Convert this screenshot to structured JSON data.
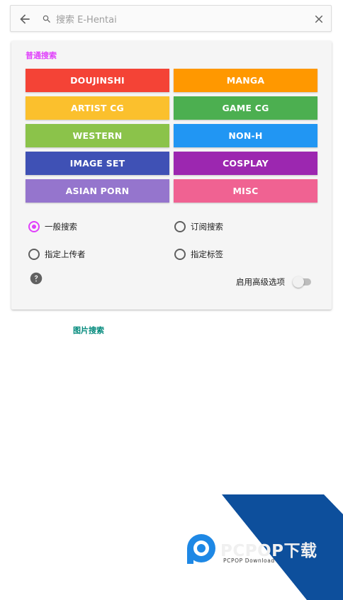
{
  "search": {
    "placeholder": "搜索 E-Hentai",
    "value": ""
  },
  "normal_search": {
    "title": "普通搜索",
    "categories": [
      {
        "label": "DOUJINSHI",
        "color": "#f44336"
      },
      {
        "label": "MANGA",
        "color": "#ff9800"
      },
      {
        "label": "ARTIST CG",
        "color": "#fbc02d"
      },
      {
        "label": "GAME CG",
        "color": "#4caf50"
      },
      {
        "label": "WESTERN",
        "color": "#8bc34a"
      },
      {
        "label": "NON-H",
        "color": "#2196f3"
      },
      {
        "label": "IMAGE SET",
        "color": "#3f51b5"
      },
      {
        "label": "COSPLAY",
        "color": "#9c27b0"
      },
      {
        "label": "ASIAN PORN",
        "color": "#9575cd"
      },
      {
        "label": "MISC",
        "color": "#f06292"
      }
    ],
    "search_modes": [
      {
        "label": "一般搜索",
        "checked": true
      },
      {
        "label": "订阅搜索",
        "checked": false
      },
      {
        "label": "指定上传者",
        "checked": false
      },
      {
        "label": "指定标签",
        "checked": false
      }
    ],
    "advanced_label": "启用高级选项",
    "advanced_enabled": false
  },
  "image_search": {
    "label": "图片搜索"
  },
  "watermark": {
    "brand": "PCPOP下载",
    "sub": "PCPOP Download"
  },
  "colors": {
    "accent": "#e040fb",
    "image_search": "#00897b",
    "watermark_blue": "#0d4f9c"
  },
  "icons": [
    "back-arrow-icon",
    "search-icon",
    "close-icon",
    "help-icon",
    "pcpop-logo"
  ]
}
